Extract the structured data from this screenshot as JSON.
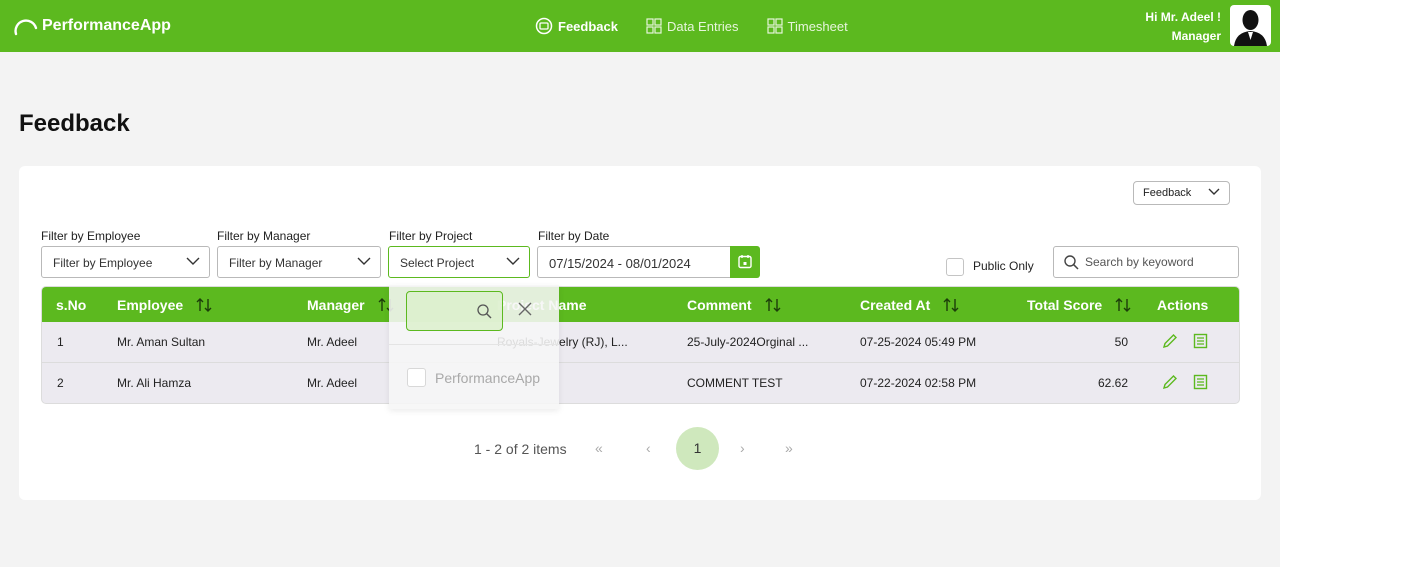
{
  "app": {
    "name": "PerformanceApp"
  },
  "nav": [
    {
      "label": "Feedback",
      "active": true,
      "icon": "feedback-icon"
    },
    {
      "label": "Data Entries",
      "active": false,
      "icon": "grid-icon"
    },
    {
      "label": "Timesheet",
      "active": false,
      "icon": "grid-icon"
    }
  ],
  "user": {
    "greeting": "Hi Mr. Adeel !",
    "role": "Manager"
  },
  "page": {
    "title": "Feedback"
  },
  "type_select": {
    "value": "Feedback"
  },
  "filters": {
    "employee": {
      "label": "Filter by Employee",
      "value": "Filter by Employee"
    },
    "manager": {
      "label": "Filter by Manager",
      "value": "Filter by Manager"
    },
    "project": {
      "label": "Filter by Project",
      "value": "Select Project"
    },
    "date": {
      "label": "Filter by Date",
      "value": "07/15/2024 - 08/01/2024"
    }
  },
  "public_only": {
    "label": "Public Only",
    "checked": false
  },
  "search": {
    "placeholder": "Search by keyoword"
  },
  "table": {
    "headers": {
      "sno": "s.No",
      "employee": "Employee",
      "manager": "Manager",
      "project": "Project Name",
      "comment": "Comment",
      "created": "Created At",
      "score": "Total Score",
      "actions": "Actions"
    },
    "rows": [
      {
        "sno": "1",
        "employee": "Mr. Aman Sultan",
        "manager": "Mr. Adeel",
        "project": "Royals-Jewelry (RJ), L...",
        "comment": "25-July-2024Orginal ...",
        "created": "07-25-2024 05:49 PM",
        "score": "50"
      },
      {
        "sno": "2",
        "employee": "Mr. Ali Hamza",
        "manager": "Mr. Adeel",
        "project": "",
        "comment": "COMMENT TEST",
        "created": "07-22-2024 02:58 PM",
        "score": "62.62"
      }
    ]
  },
  "project_dropdown": {
    "options": [
      {
        "label": "PerformanceApp",
        "checked": false
      }
    ]
  },
  "pagination": {
    "info": "1 - 2 of 2 items",
    "current": "1",
    "first": "«",
    "prev": "‹",
    "next": "›",
    "last": "»"
  },
  "colors": {
    "brand": "#5cb91f",
    "page_bg": "#f3f3f3",
    "row_bg": "#eceaf0"
  }
}
